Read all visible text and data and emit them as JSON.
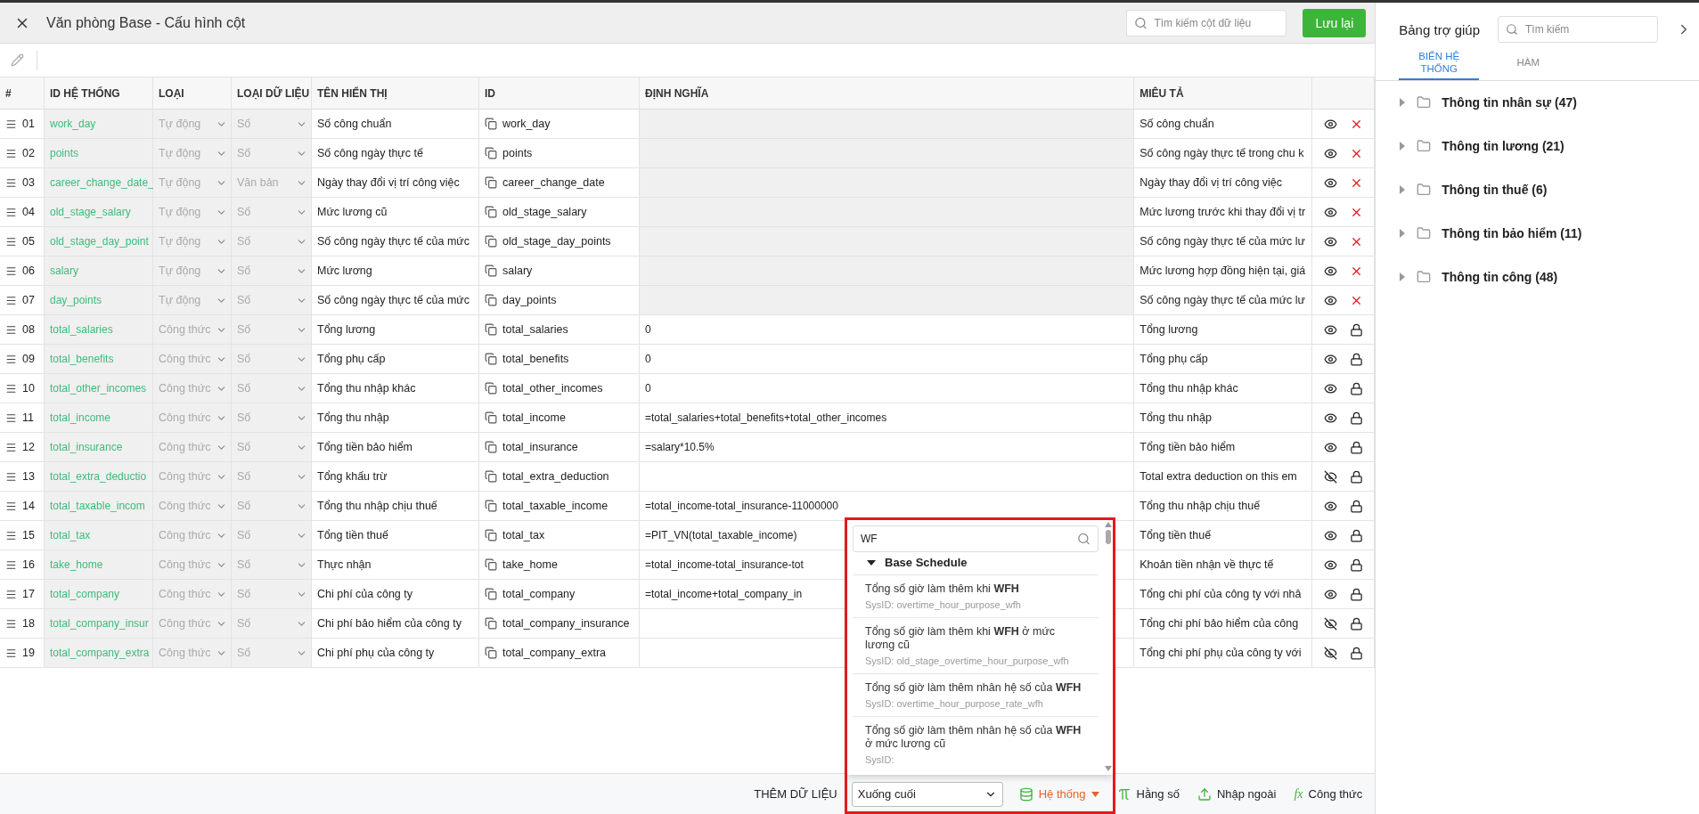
{
  "header": {
    "title": "Văn phòng Base - Cấu hình cột",
    "search_placeholder": "Tìm kiếm cột dữ liệu",
    "save_label": "Lưu lại"
  },
  "table": {
    "columns": [
      "#",
      "ID HỆ THỐNG",
      "LOẠI",
      "LOẠI DỮ LIỆU",
      "TÊN HIỂN THỊ",
      "ID",
      "ĐỊNH NGHĨA",
      "MIÊU TẢ"
    ],
    "rows": [
      {
        "num": "01",
        "sys_id": "work_day",
        "type": "Tự động",
        "data_type": "Số",
        "display_name": "Số công chuẩn",
        "id": "work_day",
        "definition": "",
        "description": "Số công chuẩn",
        "kind": "auto",
        "visible": true
      },
      {
        "num": "02",
        "sys_id": "points",
        "type": "Tự động",
        "data_type": "Số",
        "display_name": "Số công ngày thực tế",
        "id": "points",
        "definition": "",
        "description": "Số công ngày thực tế trong chu k",
        "kind": "auto",
        "visible": true
      },
      {
        "num": "03",
        "sys_id": "career_change_date_",
        "type": "Tự động",
        "data_type": "Văn bản",
        "display_name": "Ngày thay đổi vị trí công việc",
        "id": "career_change_date",
        "definition": "",
        "description": "Ngày thay đổi vị trí công việc",
        "kind": "auto",
        "visible": true
      },
      {
        "num": "04",
        "sys_id": "old_stage_salary",
        "type": "Tự động",
        "data_type": "Số",
        "display_name": "Mức lương cũ",
        "id": "old_stage_salary",
        "definition": "",
        "description": "Mức lương trước khi thay đổi vị tr",
        "kind": "auto",
        "visible": true
      },
      {
        "num": "05",
        "sys_id": "old_stage_day_point",
        "type": "Tự động",
        "data_type": "Số",
        "display_name": "Số công ngày thực tế của mức",
        "id": "old_stage_day_points",
        "definition": "",
        "description": "Số công ngày thực tế của mức lư",
        "kind": "auto",
        "visible": true
      },
      {
        "num": "06",
        "sys_id": "salary",
        "type": "Tự động",
        "data_type": "Số",
        "display_name": "Mức lương",
        "id": "salary",
        "definition": "",
        "description": "Mức lương hợp đồng hiện tại, giá",
        "kind": "auto",
        "visible": true
      },
      {
        "num": "07",
        "sys_id": "day_points",
        "type": "Tự động",
        "data_type": "Số",
        "display_name": "Số công ngày thực tế của mức",
        "id": "day_points",
        "definition": "",
        "description": "Số công ngày thực tế của mức lư",
        "kind": "auto",
        "visible": true
      },
      {
        "num": "08",
        "sys_id": "total_salaries",
        "type": "Công thức",
        "data_type": "Số",
        "display_name": "Tổng lương",
        "id": "total_salaries",
        "definition": "0",
        "description": "Tổng lương",
        "kind": "formula",
        "visible": true
      },
      {
        "num": "09",
        "sys_id": "total_benefits",
        "type": "Công thức",
        "data_type": "Số",
        "display_name": "Tổng phụ cấp",
        "id": "total_benefits",
        "definition": "0",
        "description": "Tổng phụ cấp",
        "kind": "formula",
        "visible": true
      },
      {
        "num": "10",
        "sys_id": "total_other_incomes",
        "type": "Công thức",
        "data_type": "Số",
        "display_name": "Tổng thu nhập khác",
        "id": "total_other_incomes",
        "definition": "0",
        "description": "Tổng thu nhập khác",
        "kind": "formula",
        "visible": true
      },
      {
        "num": "11",
        "sys_id": "total_income",
        "type": "Công thức",
        "data_type": "Số",
        "display_name": "Tổng thu nhập",
        "id": "total_income",
        "definition": "=total_salaries+total_benefits+total_other_incomes",
        "description": "Tổng thu nhập",
        "kind": "formula",
        "visible": true
      },
      {
        "num": "12",
        "sys_id": "total_insurance",
        "type": "Công thức",
        "data_type": "Số",
        "display_name": "Tổng tiền bảo hiểm",
        "id": "total_insurance",
        "definition": "=salary*10.5%",
        "description": "Tổng tiền bảo hiểm",
        "kind": "formula",
        "visible": true
      },
      {
        "num": "13",
        "sys_id": "total_extra_deductio",
        "type": "Công thức",
        "data_type": "Số",
        "display_name": "Tổng khấu trừ",
        "id": "total_extra_deduction",
        "definition": "",
        "description": "Total extra deduction on this em",
        "kind": "formula",
        "visible": false
      },
      {
        "num": "14",
        "sys_id": "total_taxable_incom",
        "type": "Công thức",
        "data_type": "Số",
        "display_name": "Tổng thu nhập chịu thuế",
        "id": "total_taxable_income",
        "definition": "=total_income-total_insurance-11000000",
        "description": "Tổng thu nhập chịu thuế",
        "kind": "formula",
        "visible": true
      },
      {
        "num": "15",
        "sys_id": "total_tax",
        "type": "Công thức",
        "data_type": "Số",
        "display_name": "Tổng tiền thuế",
        "id": "total_tax",
        "definition": "=PIT_VN(total_taxable_income)",
        "description": "Tổng tiền thuế",
        "kind": "formula",
        "visible": true
      },
      {
        "num": "16",
        "sys_id": "take_home",
        "type": "Công thức",
        "data_type": "Số",
        "display_name": "Thực nhận",
        "id": "take_home",
        "definition": "=total_income-total_insurance-tot",
        "description": "Khoản tiền nhận về thực tế",
        "kind": "formula",
        "visible": true
      },
      {
        "num": "17",
        "sys_id": "total_company",
        "type": "Công thức",
        "data_type": "Số",
        "display_name": "Chi phí của công ty",
        "id": "total_company",
        "definition": "=total_income+total_company_in",
        "description": "Tổng chi phí của công ty với nhâ",
        "kind": "formula",
        "visible": true
      },
      {
        "num": "18",
        "sys_id": "total_company_insur",
        "type": "Công thức",
        "data_type": "Số",
        "display_name": "Chi phí bảo hiểm của công ty",
        "id": "total_company_insurance",
        "definition": "",
        "description": "Tổng chi phí bảo hiểm của công",
        "kind": "formula",
        "visible": false
      },
      {
        "num": "19",
        "sys_id": "total_company_extra",
        "type": "Công thức",
        "data_type": "Số",
        "display_name": "Chi phí phụ của công ty",
        "id": "total_company_extra",
        "definition": "",
        "description": "Tổng chi phí phụ của công ty với",
        "kind": "formula",
        "visible": false
      }
    ]
  },
  "footer": {
    "label": "THÊM DỮ LIỆU",
    "position_select": "Xuống cuối",
    "buttons": [
      {
        "kind": "system",
        "label": "Hệ thống",
        "selected": true
      },
      {
        "kind": "constant",
        "label": "Hằng số",
        "selected": false
      },
      {
        "kind": "import",
        "label": "Nhập ngoài",
        "selected": false
      },
      {
        "kind": "formula",
        "label": "Công thức",
        "icon_text": "fx",
        "selected": false
      }
    ]
  },
  "dropdown": {
    "search_value": "WF",
    "group": "Base Schedule",
    "items": [
      {
        "title": "Tổng số giờ làm thêm khi **WFH**",
        "sys_id": "SysID: overtime_hour_purpose_wfh"
      },
      {
        "title": "Tổng số giờ làm thêm khi **WFH** ở mức lương cũ",
        "sys_id": "SysID: old_stage_overtime_hour_purpose_wfh"
      },
      {
        "title": "Tổng số giờ làm thêm nhân hệ số của **WFH**",
        "sys_id": "SysID: overtime_hour_purpose_rate_wfh"
      },
      {
        "title": "Tổng số giờ làm thêm nhân hệ số của **WFH** ở mức lương cũ",
        "sys_id": "SysID:"
      }
    ]
  },
  "help_panel": {
    "title": "Bảng trợ giúp",
    "search_placeholder": "Tìm kiếm",
    "tabs": [
      {
        "label": "BIẾN HỆ THỐNG",
        "selected": true
      },
      {
        "label": "HÀM",
        "selected": false
      }
    ],
    "tree": [
      {
        "label": "Thông tin nhân sự (47)",
        "expanded": false
      },
      {
        "label": "Thông tin lương (21)",
        "expanded": false
      },
      {
        "label": "Thông tin thuế (6)",
        "expanded": false
      },
      {
        "label": "Thông tin bảo hiểm (11)",
        "expanded": false
      },
      {
        "label": "Thông tin công (48)",
        "expanded": false
      }
    ]
  }
}
